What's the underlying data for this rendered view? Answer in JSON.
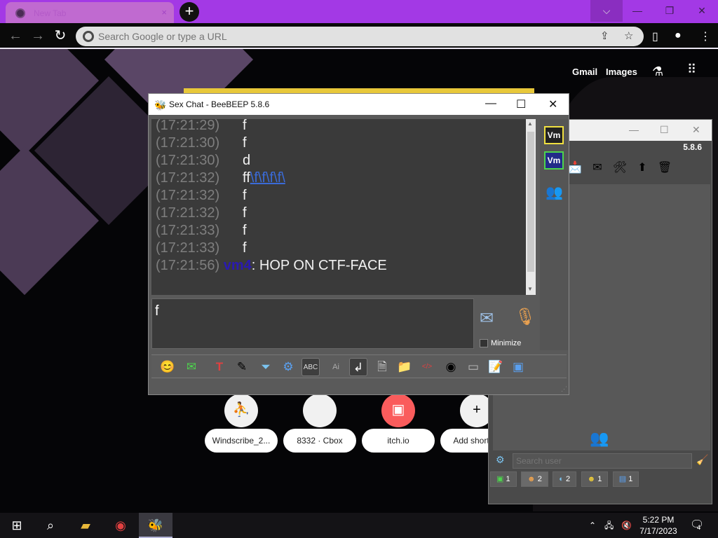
{
  "browser": {
    "tab_title": "New Tab",
    "tab_close": "×",
    "new_tab": "+",
    "omnibox_placeholder": "Search Google or type a URL",
    "window_controls": {
      "tab_search": "⌵",
      "minimize": "—",
      "restore": "❐",
      "close": "✕"
    }
  },
  "ntp": {
    "links": {
      "gmail": "Gmail",
      "images": "Images"
    },
    "shortcuts": [
      {
        "label": "Windscribe_2...",
        "glyph": "⛹"
      },
      {
        "label": "8332 · Cbox",
        "glyph": ""
      },
      {
        "label": "itch.io",
        "glyph": "▣"
      },
      {
        "label": "Add shortcut",
        "glyph": "+"
      }
    ]
  },
  "beebeep_main": {
    "version": "5.8.6",
    "search_placeholder": "Search user",
    "tabs": [
      {
        "icon": "chat-icon",
        "count": "1"
      },
      {
        "icon": "users-icon",
        "count": "2"
      },
      {
        "icon": "groups-icon",
        "count": "2"
      },
      {
        "icon": "share-icon",
        "count": "1"
      },
      {
        "icon": "files-icon",
        "count": "1"
      }
    ]
  },
  "chat": {
    "window_title": "Sex Chat - BeeBEEP 5.8.6",
    "messages": [
      {
        "time": "(17:21:29)",
        "text": "f"
      },
      {
        "time": "(17:21:30)",
        "text": "f"
      },
      {
        "time": "(17:21:30)",
        "text": "d"
      },
      {
        "time": "(17:21:32)",
        "text": "ff",
        "link": "\\f\\f\\f\\f\\"
      },
      {
        "time": "(17:21:32)",
        "text": "f"
      },
      {
        "time": "(17:21:32)",
        "text": "f"
      },
      {
        "time": "(17:21:33)",
        "text": "f"
      },
      {
        "time": "(17:21:33)",
        "text": "f"
      },
      {
        "time": "(17:21:56)",
        "nick": "vm4",
        "text": ": HOP ON CTF-FACE"
      }
    ],
    "input_value": "f",
    "minimize_label": "Minimize",
    "side_badges": [
      "Vm",
      "Vm"
    ]
  },
  "taskbar": {
    "time": "5:22 PM",
    "date": "7/17/2023",
    "notifications": "4"
  },
  "colors": {
    "tabbar": "#a339e5",
    "nick": "#2a1ab0",
    "link": "#3a6bd8",
    "timestamp": "#7e7e7e"
  }
}
